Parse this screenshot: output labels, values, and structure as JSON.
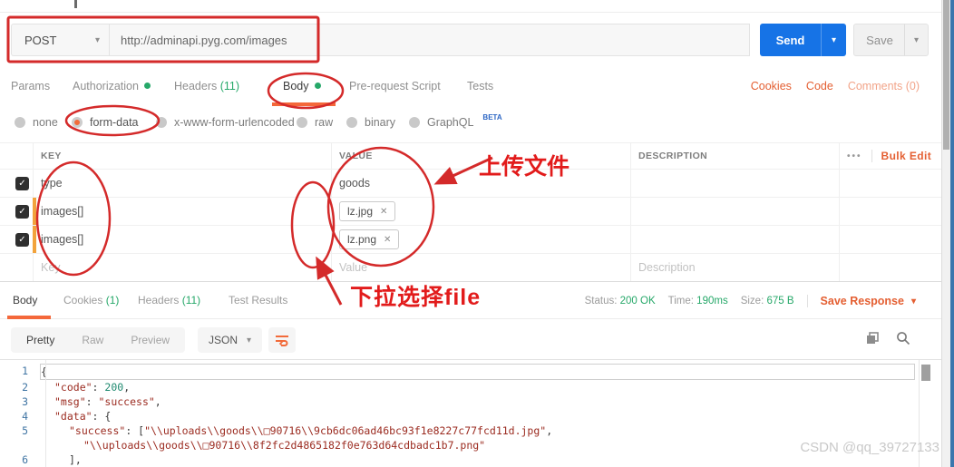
{
  "request_bar": {
    "method": "POST",
    "url": "http://adminapi.pyg.com/images",
    "send": "Send",
    "save": "Save"
  },
  "request_tabs": {
    "params": "Params",
    "authorization": "Authorization",
    "headers": "Headers",
    "headers_count": "(11)",
    "body": "Body",
    "pre_request": "Pre-request Script",
    "tests": "Tests",
    "cookies": "Cookies",
    "code": "Code",
    "comments": "Comments (0)"
  },
  "body_modes": {
    "none": "none",
    "form_data": "form-data",
    "urlencoded": "x-www-form-urlencoded",
    "raw": "raw",
    "binary": "binary",
    "graphql": "GraphQL",
    "beta": "BETA",
    "selected": "form-data"
  },
  "form_table": {
    "header": {
      "key": "KEY",
      "value": "VALUE",
      "description": "DESCRIPTION",
      "more": "•••",
      "bulk_edit": "Bulk Edit"
    },
    "rows": [
      {
        "key": "type",
        "value": "goods"
      },
      {
        "key": "images[]",
        "file": "lz.jpg"
      },
      {
        "key": "images[]",
        "file": "lz.png"
      }
    ],
    "placeholder_row": {
      "key": "Key",
      "value": "Value",
      "description": "Description"
    }
  },
  "annotations": {
    "upload_note": "上传文件",
    "dropdown_note": "下拉选择file",
    "color": "#d42a2a"
  },
  "response": {
    "tabs": {
      "body": "Body",
      "cookies": "Cookies",
      "cookies_count": "(1)",
      "headers": "Headers",
      "headers_count": "(11)",
      "test_results": "Test Results"
    },
    "status_label": "Status:",
    "status": "200 OK",
    "time_label": "Time:",
    "time": "190ms",
    "size_label": "Size:",
    "size": "675 B",
    "save_response": "Save Response",
    "modes": {
      "pretty": "Pretty",
      "raw": "Raw",
      "preview": "Preview",
      "format": "JSON"
    }
  },
  "response_body": {
    "lines": [
      {
        "num": "1",
        "indent": 0,
        "active": true,
        "tokens": [
          {
            "t": "{",
            "c": "pun"
          }
        ]
      },
      {
        "num": "2",
        "indent": 1,
        "tokens": [
          {
            "t": "\"code\"",
            "c": "key"
          },
          {
            "t": ": ",
            "c": "pun"
          },
          {
            "t": "200",
            "c": "num"
          },
          {
            "t": ",",
            "c": "pun"
          }
        ]
      },
      {
        "num": "3",
        "indent": 1,
        "tokens": [
          {
            "t": "\"msg\"",
            "c": "key"
          },
          {
            "t": ": ",
            "c": "pun"
          },
          {
            "t": "\"success\"",
            "c": "str"
          },
          {
            "t": ",",
            "c": "pun"
          }
        ]
      },
      {
        "num": "4",
        "indent": 1,
        "tokens": [
          {
            "t": "\"data\"",
            "c": "key"
          },
          {
            "t": ": {",
            "c": "pun"
          }
        ]
      },
      {
        "num": "5",
        "indent": 2,
        "tokens": [
          {
            "t": "\"success\"",
            "c": "key"
          },
          {
            "t": ": [",
            "c": "pun"
          },
          {
            "t": "\"\\\\uploads\\\\goods\\\\□90716\\\\9cb6dc06ad46bc93f1e8227c77fcd11d.jpg\"",
            "c": "str"
          },
          {
            "t": ",",
            "c": "pun"
          }
        ]
      },
      {
        "num": "",
        "indent": 3,
        "tokens": [
          {
            "t": "\"\\\\uploads\\\\goods\\\\□90716\\\\8f2fc2d4865182f0e763d64cdbadc1b7.png\"",
            "c": "str"
          }
        ]
      },
      {
        "num": "6",
        "indent": 2,
        "tokens": [
          {
            "t": "],",
            "c": "pun"
          }
        ]
      }
    ]
  },
  "icons": {
    "caret": "▾",
    "check": "✓",
    "close": "✕"
  },
  "watermark": "CSDN @qq_39727133"
}
